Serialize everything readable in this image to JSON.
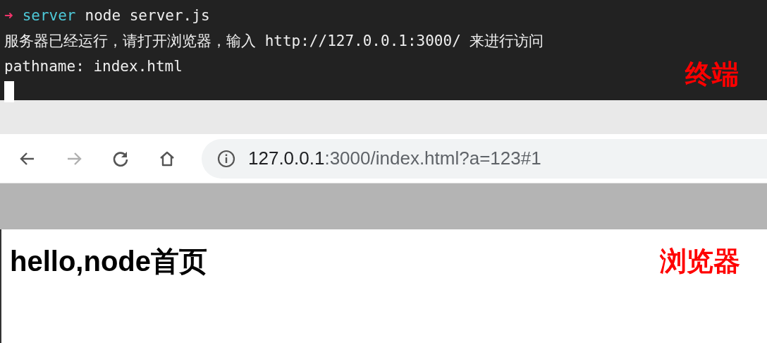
{
  "terminal": {
    "prompt_symbol": "➜",
    "directory": "server",
    "command": "node server.js",
    "output": [
      "服务器已经运行，请打开浏览器，输入 http://127.0.0.1:3000/ 来进行访问",
      "pathname: index.html"
    ],
    "annotation": "终端"
  },
  "browser": {
    "nav_buttons": [
      {
        "kind": "back",
        "disabled": false
      },
      {
        "kind": "forward",
        "disabled": true
      },
      {
        "kind": "reload",
        "disabled": false
      },
      {
        "kind": "home",
        "disabled": false
      }
    ],
    "url": {
      "host": "127.0.0.1",
      "rest": ":3000/index.html?a=123#1"
    },
    "page_heading": "hello,node首页",
    "annotation": "浏览器"
  }
}
